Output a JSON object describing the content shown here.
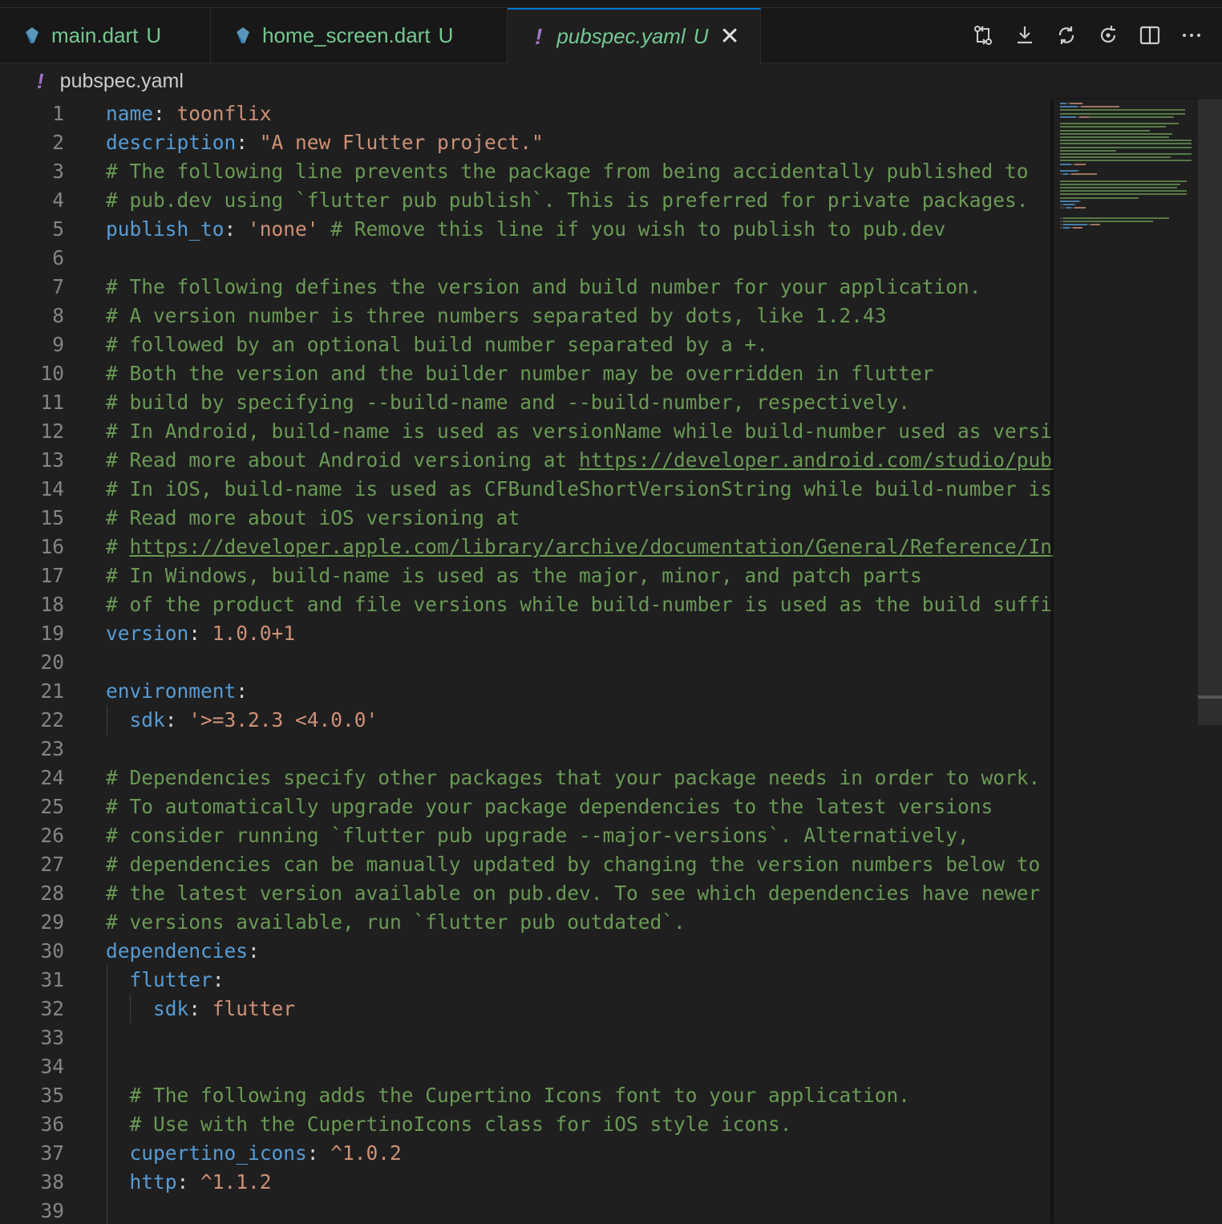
{
  "tabs": [
    {
      "label": "main.dart",
      "status": "U"
    },
    {
      "label": "home_screen.dart",
      "status": "U"
    },
    {
      "label": "pubspec.yaml",
      "status": "U",
      "active": true
    }
  ],
  "active_tab_marker": "!",
  "actions": [
    "compare-changes",
    "download",
    "sync",
    "refresh",
    "split-editor",
    "more-actions"
  ],
  "breadcrumb": {
    "marker": "!",
    "file": "pubspec.yaml"
  },
  "colors": {
    "key": "#569cd6",
    "string": "#ce9178",
    "comment": "#6a9955",
    "accent": "#0078d4",
    "modified": "#73c991",
    "yaml_icon": "#a074c4"
  },
  "editor": {
    "lines": [
      {
        "num": "1",
        "tokens": [
          {
            "t": "k",
            "v": "name"
          },
          {
            "t": "p",
            "v": ": "
          },
          {
            "t": "s",
            "v": "toonflix"
          }
        ]
      },
      {
        "num": "2",
        "tokens": [
          {
            "t": "k",
            "v": "description"
          },
          {
            "t": "p",
            "v": ": "
          },
          {
            "t": "s",
            "v": "\"A new Flutter project.\""
          }
        ]
      },
      {
        "num": "3",
        "tokens": [
          {
            "t": "c",
            "v": "# The following line prevents the package from being accidentally published to"
          }
        ]
      },
      {
        "num": "4",
        "tokens": [
          {
            "t": "c",
            "v": "# pub.dev using `flutter pub publish`. This is preferred for private packages."
          }
        ]
      },
      {
        "num": "5",
        "tokens": [
          {
            "t": "k",
            "v": "publish_to"
          },
          {
            "t": "p",
            "v": ": "
          },
          {
            "t": "s",
            "v": "'none'"
          },
          {
            "t": "c",
            "v": " # Remove this line if you wish to publish to pub.dev"
          }
        ]
      },
      {
        "num": "6",
        "tokens": []
      },
      {
        "num": "7",
        "tokens": [
          {
            "t": "c",
            "v": "# The following defines the version and build number for your application."
          }
        ]
      },
      {
        "num": "8",
        "tokens": [
          {
            "t": "c",
            "v": "# A version number is three numbers separated by dots, like 1.2.43"
          }
        ]
      },
      {
        "num": "9",
        "tokens": [
          {
            "t": "c",
            "v": "# followed by an optional build number separated by a +."
          }
        ]
      },
      {
        "num": "10",
        "tokens": [
          {
            "t": "c",
            "v": "# Both the version and the builder number may be overridden in flutter"
          }
        ]
      },
      {
        "num": "11",
        "tokens": [
          {
            "t": "c",
            "v": "# build by specifying --build-name and --build-number, respectively."
          }
        ]
      },
      {
        "num": "12",
        "tokens": [
          {
            "t": "c",
            "v": "# In Android, build-name is used as versionName while build-number used as version"
          }
        ]
      },
      {
        "num": "13",
        "tokens": [
          {
            "t": "c",
            "v": "# Read more about Android versioning at "
          },
          {
            "t": "u",
            "v": "https://developer.android.com/studio/publi"
          }
        ]
      },
      {
        "num": "14",
        "tokens": [
          {
            "t": "c",
            "v": "# In iOS, build-name is used as CFBundleShortVersionString while build-number is u"
          }
        ]
      },
      {
        "num": "15",
        "tokens": [
          {
            "t": "c",
            "v": "# Read more about iOS versioning at"
          }
        ]
      },
      {
        "num": "16",
        "tokens": [
          {
            "t": "c",
            "v": "# "
          },
          {
            "t": "u",
            "v": "https://developer.apple.com/library/archive/documentation/General/Reference/Info"
          }
        ]
      },
      {
        "num": "17",
        "tokens": [
          {
            "t": "c",
            "v": "# In Windows, build-name is used as the major, minor, and patch parts"
          }
        ]
      },
      {
        "num": "18",
        "tokens": [
          {
            "t": "c",
            "v": "# of the product and file versions while build-number is used as the build suffix."
          }
        ]
      },
      {
        "num": "19",
        "tokens": [
          {
            "t": "k",
            "v": "version"
          },
          {
            "t": "p",
            "v": ": "
          },
          {
            "t": "n",
            "v": "1.0.0+1"
          }
        ]
      },
      {
        "num": "20",
        "tokens": []
      },
      {
        "num": "21",
        "tokens": [
          {
            "t": "k",
            "v": "environment"
          },
          {
            "t": "p",
            "v": ":"
          }
        ]
      },
      {
        "num": "22",
        "tokens": [
          {
            "t": "p",
            "v": "  "
          },
          {
            "t": "k",
            "v": "sdk"
          },
          {
            "t": "p",
            "v": ": "
          },
          {
            "t": "s",
            "v": "'>=3.2.3 <4.0.0'"
          }
        ]
      },
      {
        "num": "23",
        "tokens": []
      },
      {
        "num": "24",
        "tokens": [
          {
            "t": "c",
            "v": "# Dependencies specify other packages that your package needs in order to work."
          }
        ]
      },
      {
        "num": "25",
        "tokens": [
          {
            "t": "c",
            "v": "# To automatically upgrade your package dependencies to the latest versions"
          }
        ]
      },
      {
        "num": "26",
        "tokens": [
          {
            "t": "c",
            "v": "# consider running `flutter pub upgrade --major-versions`. Alternatively,"
          }
        ]
      },
      {
        "num": "27",
        "tokens": [
          {
            "t": "c",
            "v": "# dependencies can be manually updated by changing the version numbers below to"
          }
        ]
      },
      {
        "num": "28",
        "tokens": [
          {
            "t": "c",
            "v": "# the latest version available on pub.dev. To see which dependencies have newer"
          }
        ]
      },
      {
        "num": "29",
        "tokens": [
          {
            "t": "c",
            "v": "# versions available, run `flutter pub outdated`."
          }
        ]
      },
      {
        "num": "30",
        "tokens": [
          {
            "t": "k",
            "v": "dependencies"
          },
          {
            "t": "p",
            "v": ":"
          }
        ]
      },
      {
        "num": "31",
        "tokens": [
          {
            "t": "p",
            "v": "  "
          },
          {
            "t": "k",
            "v": "flutter"
          },
          {
            "t": "p",
            "v": ":"
          }
        ]
      },
      {
        "num": "32",
        "tokens": [
          {
            "t": "p",
            "v": "    "
          },
          {
            "t": "k",
            "v": "sdk"
          },
          {
            "t": "p",
            "v": ": "
          },
          {
            "t": "s",
            "v": "flutter"
          }
        ]
      },
      {
        "num": "33",
        "tokens": []
      },
      {
        "num": "34",
        "tokens": []
      },
      {
        "num": "35",
        "tokens": [
          {
            "t": "p",
            "v": "  "
          },
          {
            "t": "c",
            "v": "# The following adds the Cupertino Icons font to your application."
          }
        ]
      },
      {
        "num": "36",
        "tokens": [
          {
            "t": "p",
            "v": "  "
          },
          {
            "t": "c",
            "v": "# Use with the CupertinoIcons class for iOS style icons."
          }
        ]
      },
      {
        "num": "37",
        "tokens": [
          {
            "t": "p",
            "v": "  "
          },
          {
            "t": "k",
            "v": "cupertino_icons"
          },
          {
            "t": "p",
            "v": ": "
          },
          {
            "t": "n",
            "v": "^1.0.2"
          }
        ]
      },
      {
        "num": "38",
        "tokens": [
          {
            "t": "p",
            "v": "  "
          },
          {
            "t": "k",
            "v": "http"
          },
          {
            "t": "p",
            "v": ": "
          },
          {
            "t": "n",
            "v": "^1.1.2"
          }
        ]
      },
      {
        "num": "39",
        "tokens": []
      }
    ]
  }
}
